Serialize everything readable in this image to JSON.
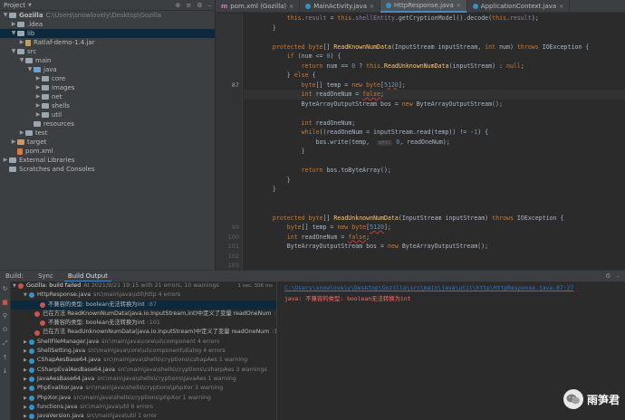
{
  "project_panel": {
    "title": "Project",
    "tree": [
      {
        "indent": 0,
        "arrow": "▼",
        "icon": "fold-gray",
        "label": "Gozilla",
        "muted": "C:\\Users\\snowlovely\\Desktop\\Gozilla",
        "bold": true
      },
      {
        "indent": 1,
        "arrow": "▶",
        "icon": "fold-gray",
        "label": ".idea",
        "muted": ""
      },
      {
        "indent": 1,
        "arrow": "▼",
        "icon": "fold-gray",
        "label": "lib",
        "muted": "",
        "selected": true
      },
      {
        "indent": 2,
        "arrow": "▶",
        "icon": "file-jar",
        "label": "Ratlaf-demo-1.4.jar",
        "muted": ""
      },
      {
        "indent": 1,
        "arrow": "▼",
        "icon": "fold-gray",
        "label": "src",
        "muted": ""
      },
      {
        "indent": 2,
        "arrow": "▼",
        "icon": "fold-gray",
        "label": "main",
        "muted": ""
      },
      {
        "indent": 3,
        "arrow": "▼",
        "icon": "fold-blue",
        "label": "java",
        "muted": ""
      },
      {
        "indent": 4,
        "arrow": "▶",
        "icon": "fold-gray",
        "label": "core",
        "muted": ""
      },
      {
        "indent": 4,
        "arrow": "▶",
        "icon": "fold-gray",
        "label": "images",
        "muted": ""
      },
      {
        "indent": 4,
        "arrow": "▶",
        "icon": "fold-gray",
        "label": "net",
        "muted": ""
      },
      {
        "indent": 4,
        "arrow": "▶",
        "icon": "fold-gray",
        "label": "shells",
        "muted": ""
      },
      {
        "indent": 4,
        "arrow": "▶",
        "icon": "fold-gray",
        "label": "util",
        "muted": ""
      },
      {
        "indent": 3,
        "arrow": "",
        "icon": "fold-gray",
        "label": "resources",
        "muted": ""
      },
      {
        "indent": 2,
        "arrow": "▶",
        "icon": "fold-gray",
        "label": "test",
        "muted": ""
      },
      {
        "indent": 1,
        "arrow": "▶",
        "icon": "fold-orange",
        "label": "target",
        "muted": ""
      },
      {
        "indent": 1,
        "arrow": "",
        "icon": "file-xml",
        "label": "pom.xml",
        "muted": ""
      },
      {
        "indent": 0,
        "arrow": "▶",
        "icon": "fold-gray",
        "label": "External Libraries",
        "muted": ""
      },
      {
        "indent": 0,
        "arrow": "",
        "icon": "fold-gray",
        "label": "Scratches and Consoles",
        "muted": ""
      }
    ]
  },
  "editor_tabs": [
    {
      "label": "pom.xml (Gozilla)",
      "icon": "m",
      "active": false
    },
    {
      "label": "MainActivity.java",
      "icon": "j",
      "active": false
    },
    {
      "label": "HttpResponse.java",
      "icon": "j",
      "active": true
    },
    {
      "label": "ApplicationContext.java",
      "icon": "j",
      "active": false
    }
  ],
  "line_numbers": [
    "",
    "",
    "",
    "",
    "",
    "",
    "",
    "87",
    "",
    "",
    "",
    "",
    "",
    "",
    "",
    "",
    "",
    "",
    "",
    "",
    "",
    "",
    "99",
    "100",
    "101",
    "102",
    "103",
    ""
  ],
  "code_lines": [
    {
      "t": "        this.result = this.shellEntity.getCryptionModel().decode(this.result);"
    },
    {
      "t": "    }"
    },
    {
      "t": ""
    },
    {
      "t": "    protected byte[] ReadKnownNumData(InputStream inputStream, int num) throws IOException {"
    },
    {
      "t": "        if (num <= 0) {"
    },
    {
      "t": "            return num == 0 ? this.ReadUnknownNumData(inputStream) : null;"
    },
    {
      "t": "        } else {"
    },
    {
      "t": "            byte[] temp = new byte[5120];"
    },
    {
      "t": "            int readOneNum = false;"
    },
    {
      "t": "            ByteArrayOutputStream bos = new ByteArrayOutputStream();"
    },
    {
      "t": ""
    },
    {
      "t": "            int readOneNum;"
    },
    {
      "t": "            while((readOneNum = inputStream.read(temp)) != -1) {"
    },
    {
      "t": "                bos.write(temp,  off: 0, readOneNum);"
    },
    {
      "t": "            }"
    },
    {
      "t": ""
    },
    {
      "t": "            return bos.toByteArray();"
    },
    {
      "t": "        }"
    },
    {
      "t": "    }"
    },
    {
      "t": ""
    },
    {
      "t": ""
    },
    {
      "t": "    protected byte[] ReadUnknownNumData(InputStream inputStream) throws IOException {"
    },
    {
      "t": "        byte[] temp = new byte[5120];"
    },
    {
      "t": "        int readOneNum = false;"
    },
    {
      "t": "        ByteArrayOutputStream bos = new ByteArrayOutputStream();"
    }
  ],
  "build_panel": {
    "tabs": [
      "Build:",
      "Sync",
      "Build Output"
    ],
    "tree": [
      {
        "indent": 0,
        "kind": "error",
        "label": "Gozilla: build failed",
        "muted": "At 2021/9/21 19:15 with 21 errors, 10 warnings",
        "time": "1 sec, 306 ms"
      },
      {
        "indent": 1,
        "kind": "file",
        "label": "HttpResponse.java",
        "muted": "src\\main\\java\\util\\http 4 errors"
      },
      {
        "indent": 2,
        "kind": "error",
        "label": "不兼容的类型: boolean无法转换为int",
        "muted": ":87",
        "selected": true
      },
      {
        "indent": 2,
        "kind": "error",
        "label": "已在方法 ReadKnownNumData(java.io.InputStream,int)中定义了变量 readOneNum",
        "muted": ":90"
      },
      {
        "indent": 2,
        "kind": "error",
        "label": "不兼容的类型: boolean无法转换为int",
        "muted": ":101"
      },
      {
        "indent": 2,
        "kind": "error",
        "label": "已在方法 ReadUnknownNumData(java.io.InputStream)中定义了变量 readOneNum",
        "muted": ":104"
      },
      {
        "indent": 1,
        "kind": "file",
        "label": "ShellFileManager.java",
        "muted": "src\\main\\java\\core\\ui\\component 4 errors"
      },
      {
        "indent": 1,
        "kind": "file",
        "label": "ShellSetting.java",
        "muted": "src\\main\\java\\core\\ui\\component\\dialog 4 errors"
      },
      {
        "indent": 1,
        "kind": "file",
        "label": "CShapAesBase64.java",
        "muted": "src\\main\\java\\shells\\cryptions\\cshapAes 1 warning"
      },
      {
        "indent": 1,
        "kind": "file",
        "label": "CSharpEvalAesBase64.java",
        "muted": "src\\main\\java\\shells\\cryptions\\csharpAes 3 warnings"
      },
      {
        "indent": 1,
        "kind": "file",
        "label": "JavaAesBase64.java",
        "muted": "src\\main\\java\\shells\\cryptions\\JavaAes 1 warning"
      },
      {
        "indent": 1,
        "kind": "file",
        "label": "PhpEvalXor.java",
        "muted": "src\\main\\java\\shells\\cryptions\\phpXor 3 warning"
      },
      {
        "indent": 1,
        "kind": "file",
        "label": "PhpXor.java",
        "muted": "src\\main\\java\\shells\\cryptions\\phpXor 1 warning"
      },
      {
        "indent": 1,
        "kind": "file",
        "label": "functions.java",
        "muted": "src\\main\\java\\util 6 errors"
      },
      {
        "indent": 1,
        "kind": "file",
        "label": "JavaVersion.java",
        "muted": "src\\main\\java\\util 1 error"
      }
    ],
    "output_link": "C:\\Users\\snowlovely\\Desktop\\Gozilla\\src\\main\\java\\util\\http\\HttpResponse.java:87:27",
    "output_error": "java: 不兼容的类型: boolean无法转换为int"
  },
  "watermark": {
    "text": "雨笋君"
  }
}
